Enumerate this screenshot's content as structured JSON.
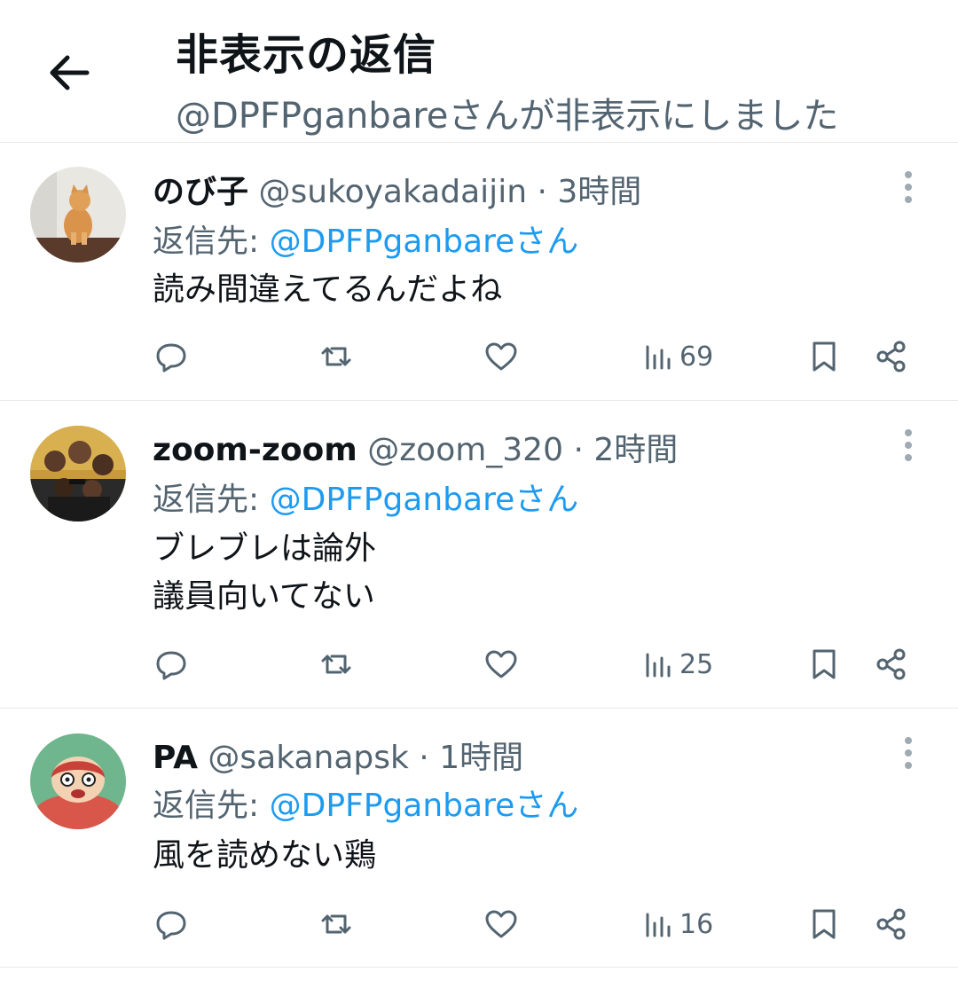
{
  "header": {
    "title": "非表示の返信",
    "subtitle": "@DPFPganbareさんが非表示にしました"
  },
  "reply_prefix": "返信先:",
  "tweets": [
    {
      "name": "のび子",
      "handle": "@sukoyakadaijin",
      "separator": "·",
      "time": "3時間",
      "reply_to": "@DPFPganbareさん",
      "lines": [
        "読み間違えてるんだよね",
        ""
      ],
      "views": "69"
    },
    {
      "name": "zoom-zoom",
      "handle": "@zoom_320",
      "separator": "·",
      "time": "2時間",
      "reply_to": "@DPFPganbareさん",
      "lines": [
        "ブレブレは論外",
        "議員向いてない"
      ],
      "views": "25"
    },
    {
      "name": "PA",
      "handle": "@sakanapsk",
      "separator": "·",
      "time": "1時間",
      "reply_to": "@DPFPganbareさん",
      "lines": [
        "風を読めない鶏",
        ""
      ],
      "views": "16"
    }
  ],
  "colors": {
    "link": "#1d9bf0",
    "secondary": "#536471",
    "text": "#0f1419",
    "divider": "#e6e9ec"
  }
}
